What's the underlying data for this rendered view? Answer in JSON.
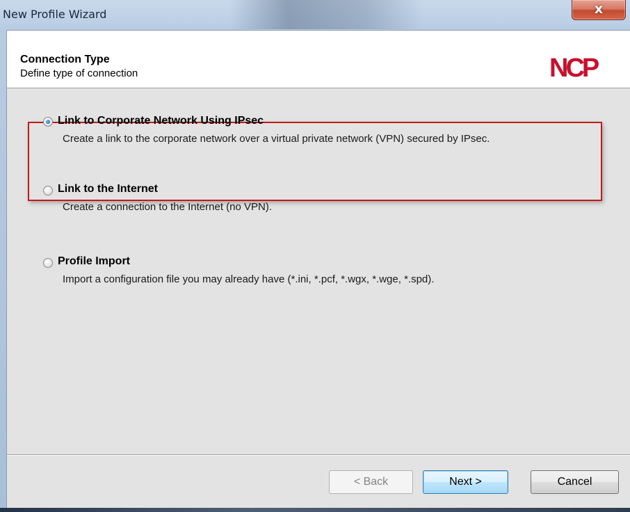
{
  "window": {
    "title": "New Profile Wizard",
    "close_glyph": "x"
  },
  "header": {
    "title": "Connection Type",
    "subtitle": "Define type of connection",
    "logo_text": "NCP",
    "logo_color": "#c8102e"
  },
  "options": [
    {
      "title": "Link to Corporate Network Using IPsec",
      "description": "Create a link to the corporate network over a virtual private network (VPN) secured by IPsec.",
      "selected": true
    },
    {
      "title": "Link to the Internet",
      "description": "Create a connection to the Internet (no VPN).",
      "selected": false
    },
    {
      "title": "Profile Import",
      "description": "Import a configuration file you may already have (*.ini, *.pcf, *.wgx, *.wge, *.spd).",
      "selected": false
    }
  ],
  "buttons": {
    "back": "< Back",
    "next": "Next >",
    "cancel": "Cancel"
  },
  "colors": {
    "highlight_border": "#c21a1a",
    "radio_selected": "#2a7fc6"
  }
}
